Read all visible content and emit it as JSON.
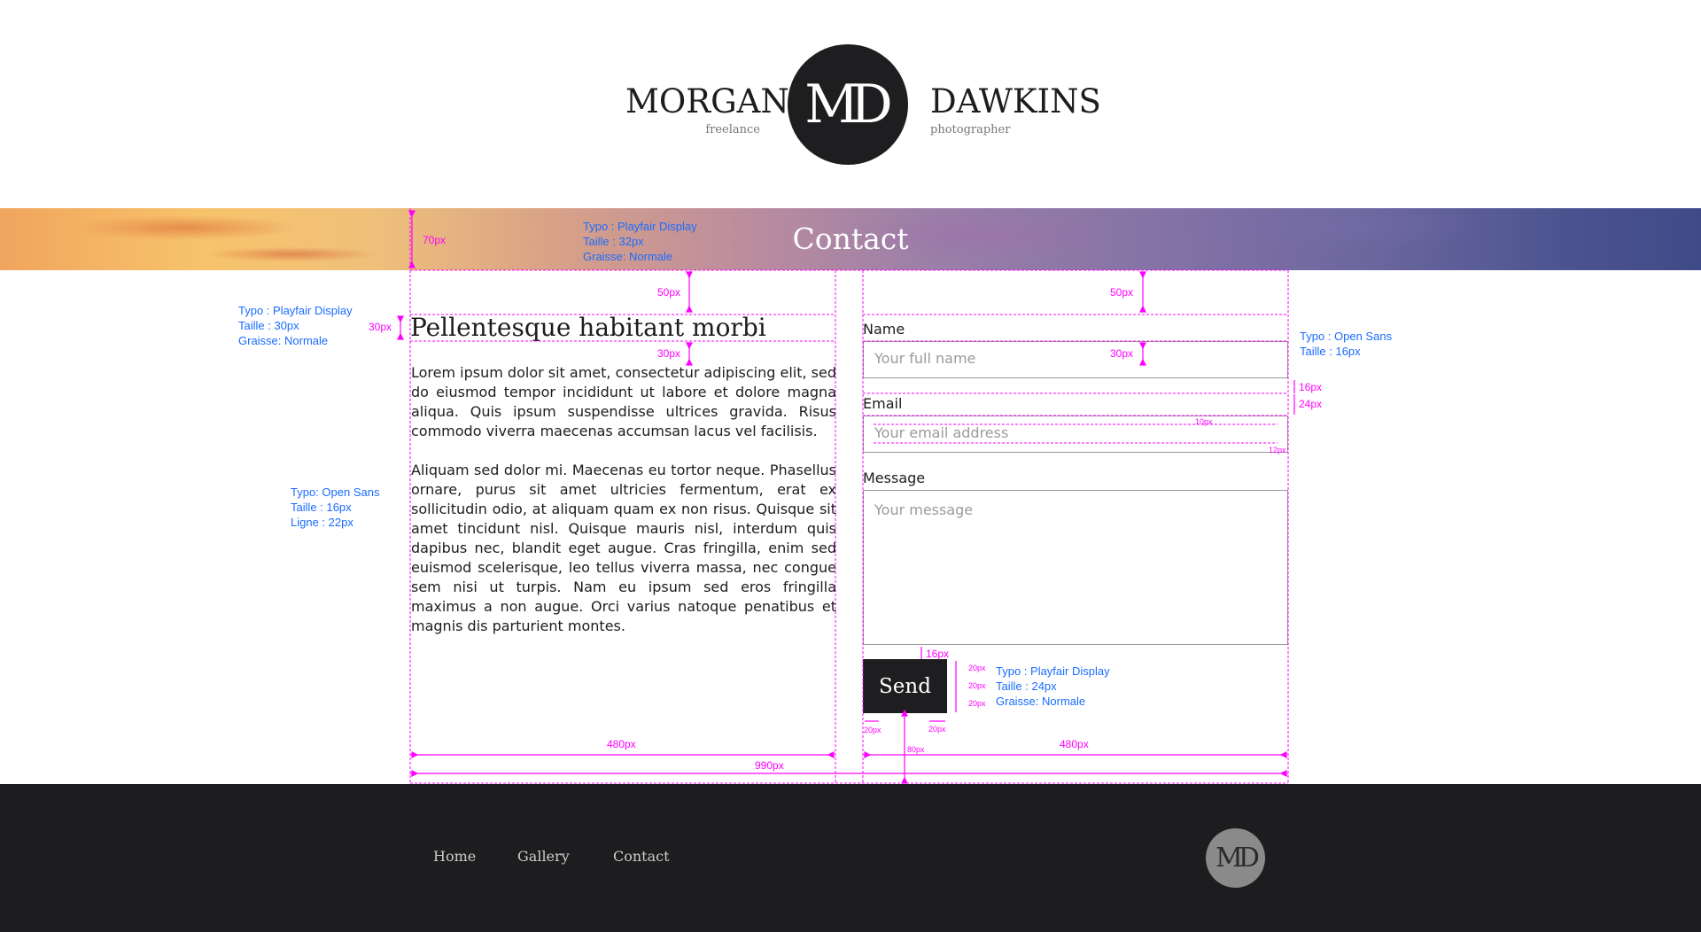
{
  "header": {
    "first_name": "MORGAN",
    "first_sub": "freelance",
    "logo_text": "MD",
    "last_name": "DAWKINS",
    "last_sub": "photographer"
  },
  "banner": {
    "title": "Contact"
  },
  "left": {
    "heading": "Pellentesque habitant morbi",
    "paragraph1": "Lorem ipsum dolor sit amet, consectetur adipiscing elit, sed do eiusmod tempor incididunt ut labore et dolore magna aliqua. Quis ipsum suspendisse ultrices gravida. Risus commodo viverra maecenas accumsan lacus vel facilisis.",
    "paragraph2": "Aliquam sed dolor mi. Maecenas eu tortor neque. Phasellus ornare, purus sit amet ultricies fermentum, erat ex sollicitudin odio, at aliquam quam ex non risus. Quisque sit amet tincidunt nisl. Quisque mauris nisl, interdum quis dapibus nec, blandit eget augue. Cras fringilla, enim sed euismod scelerisque, leo tellus viverra massa, nec congue sem nisi ut turpis. Nam eu ipsum sed eros fringilla maximus a non augue. Orci varius natoque penatibus et magnis dis parturient montes."
  },
  "form": {
    "name_label": "Name",
    "name_placeholder": "Your full name",
    "email_label": "Email",
    "email_placeholder": "Your email address",
    "message_label": "Message",
    "message_placeholder": "Your message",
    "send_label": "Send"
  },
  "annotations": {
    "banner_font": [
      "Typo : Playfair Display",
      "Taille : 32px",
      "Graisse: Normale"
    ],
    "heading_font": [
      "Typo : Playfair Display",
      "Taille : 30px",
      "Graisse: Normale"
    ],
    "body_font": [
      "Typo: Open Sans",
      "Taille : 16px",
      "Ligne : 22px"
    ],
    "form_font": [
      "Typo : Open Sans",
      "Taille : 16px"
    ],
    "button_font": [
      "Typo : Playfair Display",
      "Taille : 24px",
      "Graisse: Normale"
    ],
    "m70": "70px",
    "m50a": "50px",
    "m50b": "50px",
    "m30a": "30px",
    "m30b": "30px",
    "m30c": "30px",
    "m16a": "16px",
    "m24": "24px",
    "m16b": "16px",
    "m10": "10px",
    "m12": "12px",
    "m20a": "20px",
    "m20b": "20px",
    "m20c": "20px",
    "m20d": "20px",
    "m20e": "20px",
    "m80": "80px",
    "w480a": "480px",
    "w480b": "480px",
    "w990": "990px"
  },
  "footer": {
    "nav": [
      "Home",
      "Gallery",
      "Contact"
    ],
    "logo_text": "MD"
  },
  "colors": {
    "dark": "#1d1c1e",
    "annotation_blue": "#1a6cff",
    "guide_magenta": "#ff00ff",
    "footer_logo": "#8a8a8a"
  }
}
